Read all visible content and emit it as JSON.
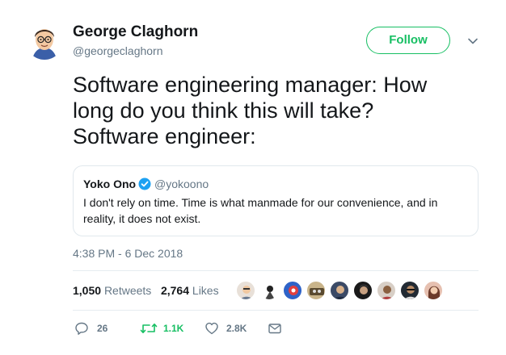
{
  "author": {
    "name": "George Claghorn",
    "handle": "@georgeclaghorn",
    "avatar_icon": "cartoon-avatar-icon"
  },
  "follow_label": "Follow",
  "tweet_lines": [
    "Software engineering manager: How",
    "long do you think this will take?",
    "Software engineer:"
  ],
  "quote": {
    "name": "Yoko Ono",
    "verified_icon": "verified-badge-icon",
    "handle": "@yokoono",
    "text": "I don't rely on time. Time is what manmade for our convenience, and in reality, it does not exist."
  },
  "timestamp": "4:38 PM - 6 Dec 2018",
  "stats": {
    "retweets_count": "1,050",
    "retweets_label": "Retweets",
    "likes_count": "2,764",
    "likes_label": "Likes"
  },
  "actions": {
    "reply_count": "26",
    "retweet_count": "1.1K",
    "like_count": "2.8K"
  },
  "colors": {
    "accent_green": "#17bf63",
    "secondary_text": "#657786",
    "verified_blue": "#1da1f2"
  }
}
